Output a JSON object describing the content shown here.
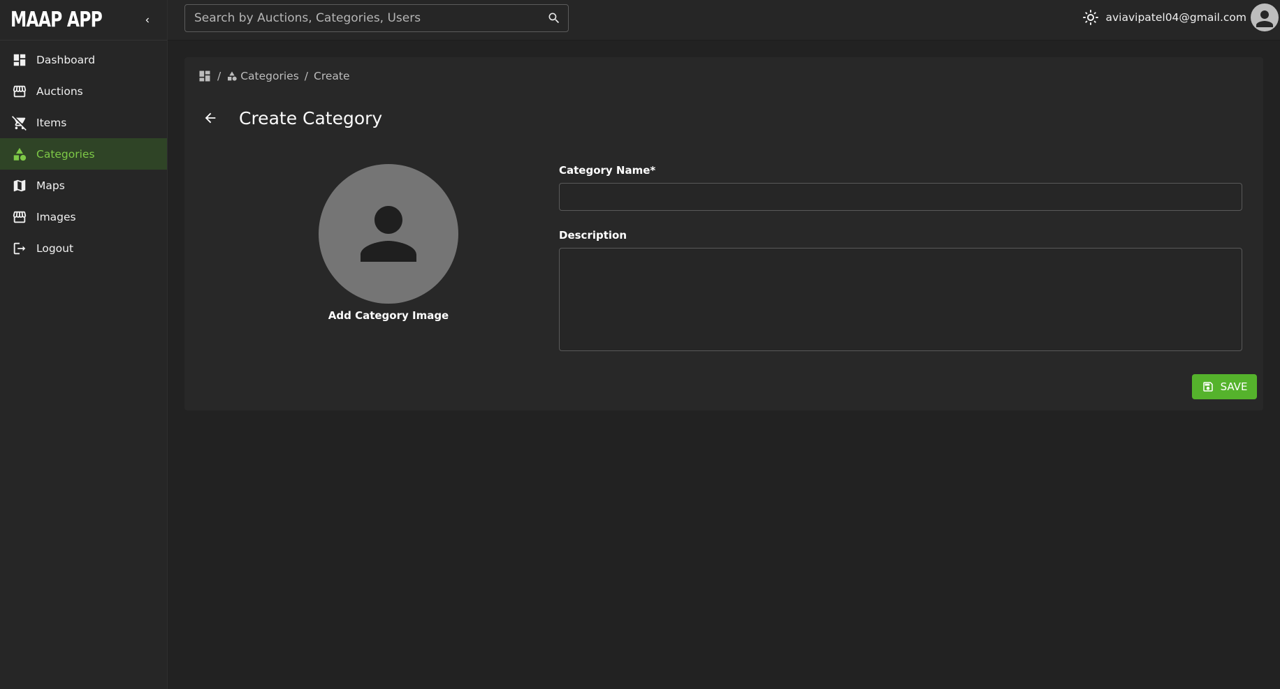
{
  "app": {
    "title": "MAAP APP"
  },
  "search": {
    "placeholder": "Search by Auctions, Categories, Users"
  },
  "user": {
    "email": "aviavipatel04@gmail.com"
  },
  "sidebar": {
    "items": [
      {
        "label": "Dashboard",
        "icon": "dashboard-icon",
        "active": false
      },
      {
        "label": "Auctions",
        "icon": "storefront-icon",
        "active": false
      },
      {
        "label": "Items",
        "icon": "cart-icon",
        "active": false
      },
      {
        "label": "Categories",
        "icon": "category-shapes-icon",
        "active": true
      },
      {
        "label": "Maps",
        "icon": "map-icon",
        "active": false
      },
      {
        "label": "Images",
        "icon": "storefront-icon",
        "active": false
      },
      {
        "label": "Logout",
        "icon": "logout-icon",
        "active": false
      }
    ]
  },
  "breadcrumb": {
    "separator": "/",
    "categories": "Categories",
    "current": "Create"
  },
  "page": {
    "title": "Create Category"
  },
  "image_upload": {
    "label": "Add Category Image"
  },
  "form": {
    "name_label": "Category Name*",
    "name_value": "",
    "description_label": "Description",
    "description_value": ""
  },
  "actions": {
    "save_label": "SAVE"
  },
  "colors": {
    "accent": "#55b32c",
    "active_bg": "#2f4426",
    "active_text": "#7ec947",
    "background": "#222222",
    "card": "#282828"
  }
}
